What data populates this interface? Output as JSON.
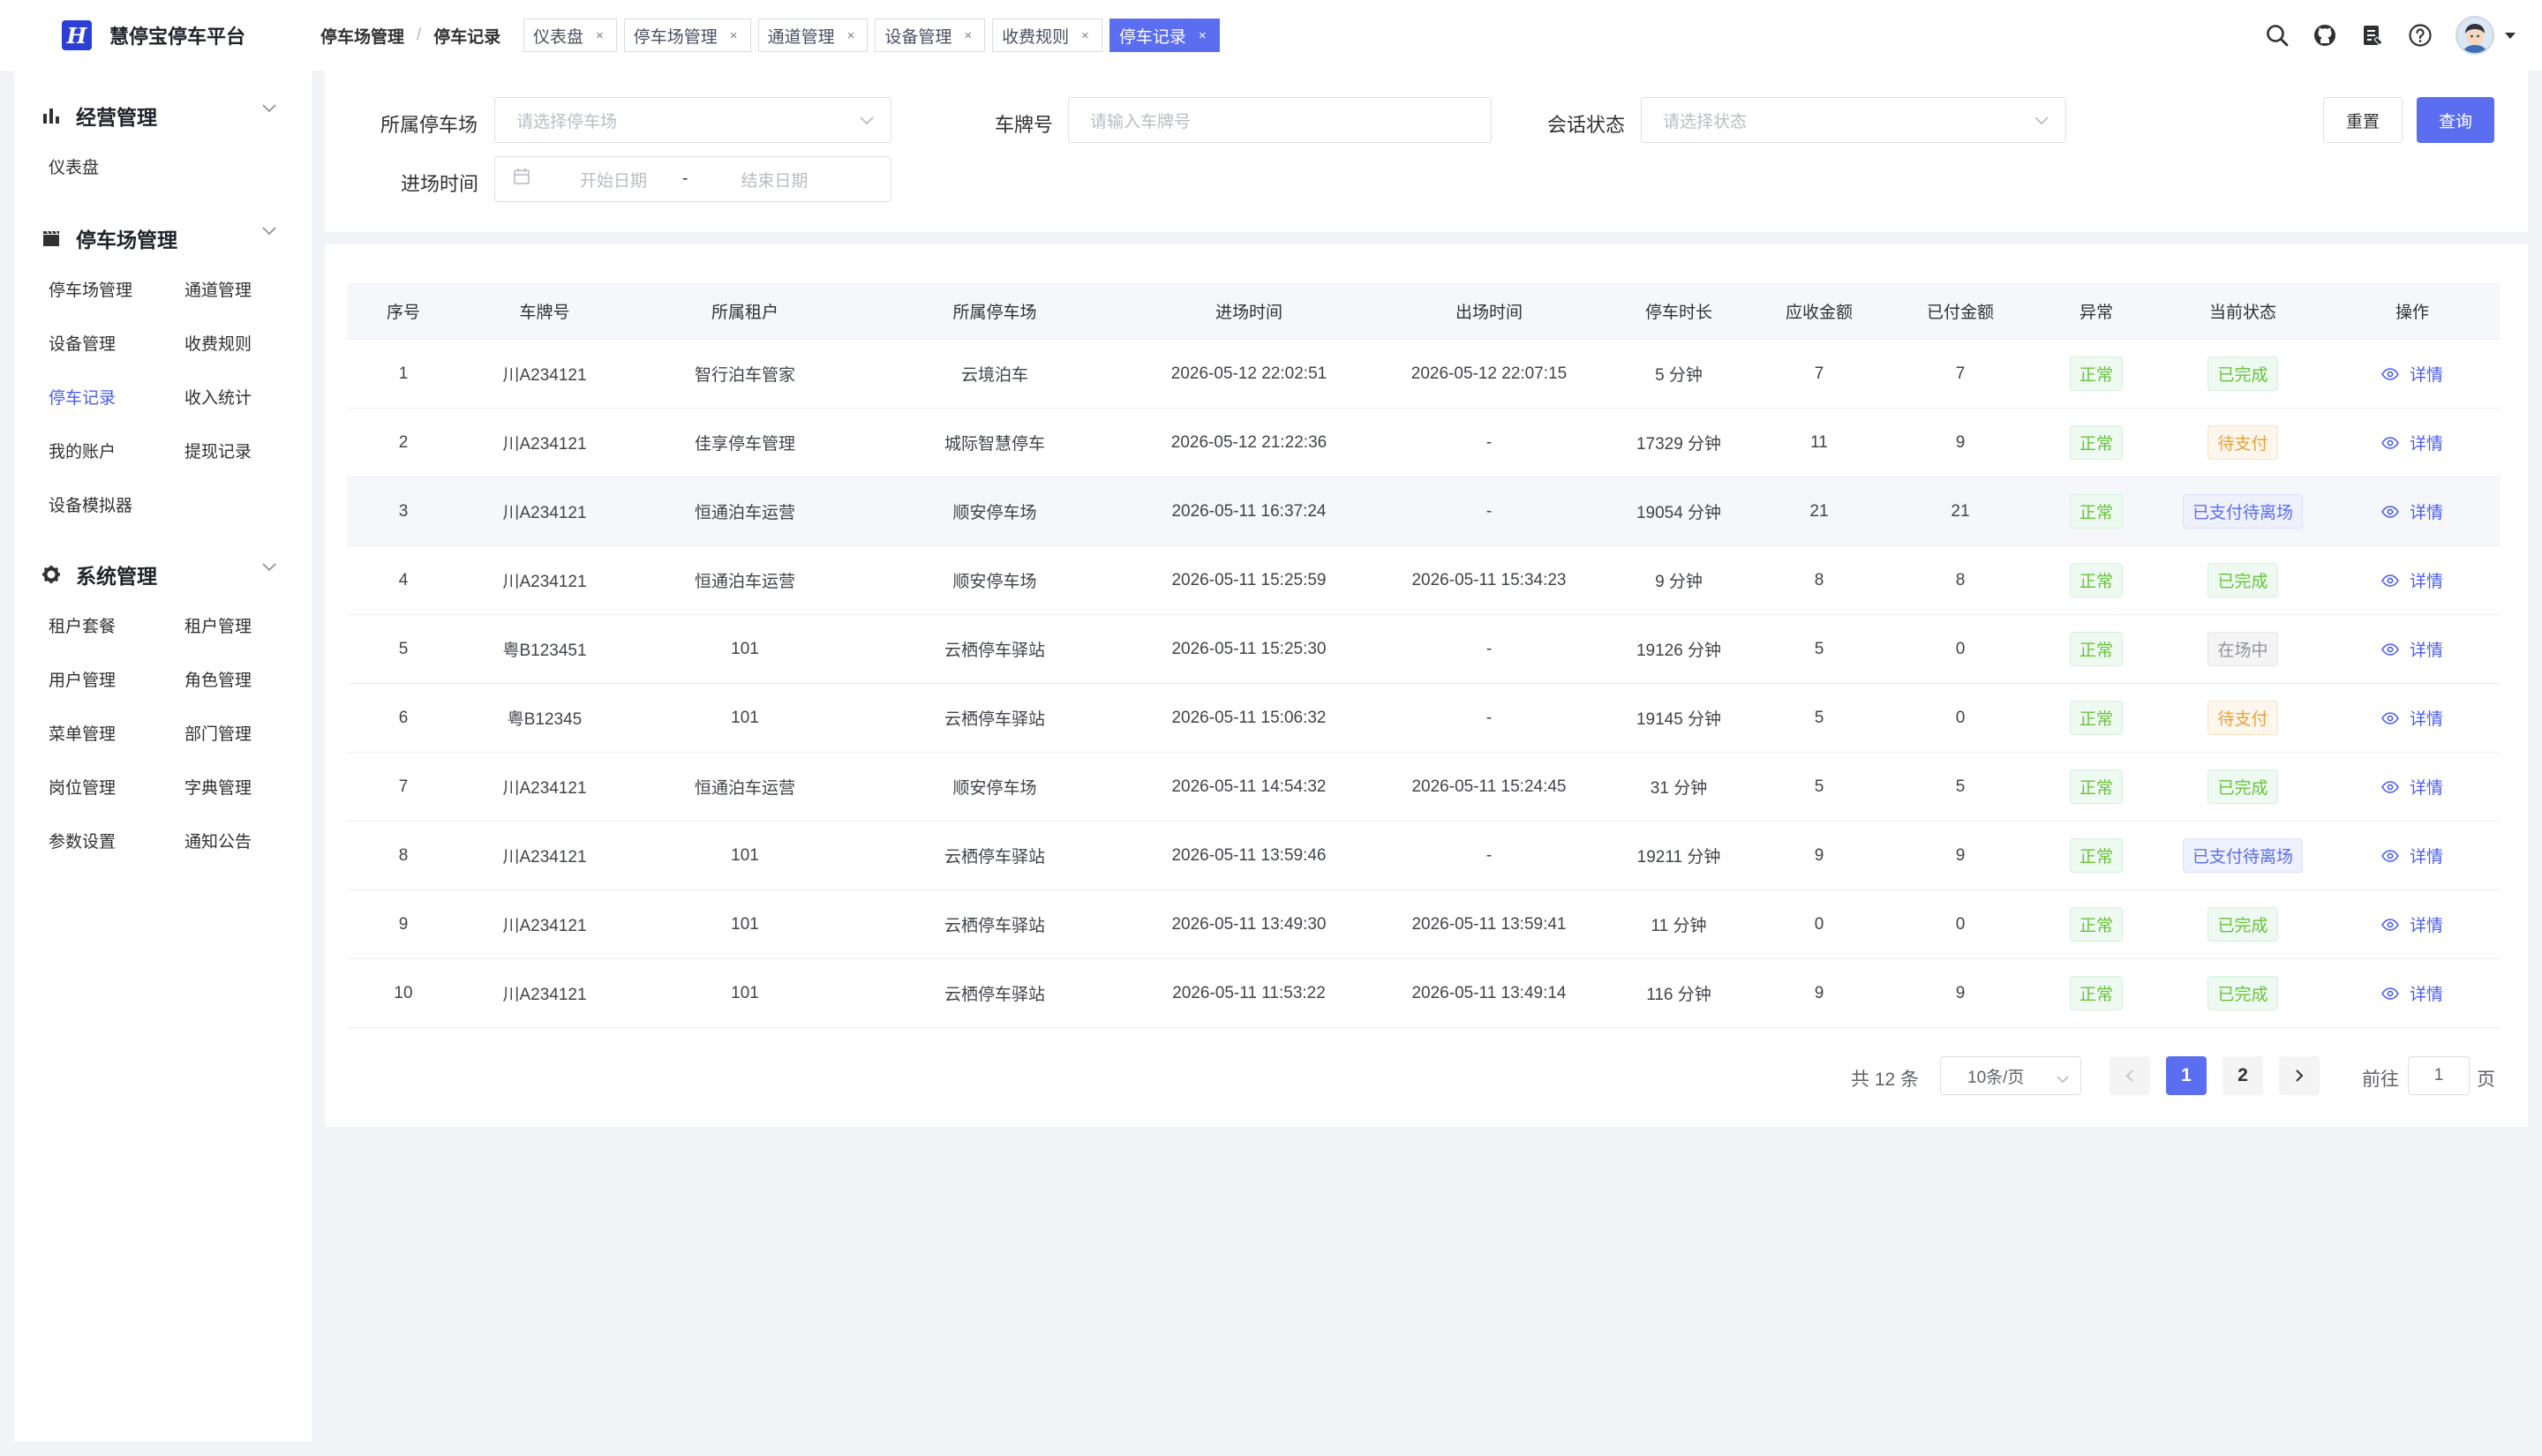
{
  "brand": {
    "name": "慧停宝停车平台",
    "logo_letter": "H"
  },
  "breadcrumb": {
    "parent": "停车场管理",
    "separator": "/",
    "current": "停车记录"
  },
  "tags": [
    {
      "label": "仪表盘",
      "close": "×",
      "active": false
    },
    {
      "label": "停车场管理",
      "close": "×",
      "active": false
    },
    {
      "label": "通道管理",
      "close": "×",
      "active": false
    },
    {
      "label": "设备管理",
      "close": "×",
      "active": false
    },
    {
      "label": "收费规则",
      "close": "×",
      "active": false
    },
    {
      "label": "停车记录",
      "close": "×",
      "active": true
    }
  ],
  "header_icons": [
    "search-icon",
    "github-icon",
    "document-icon",
    "help-icon",
    "avatar"
  ],
  "sidebar": {
    "groups": [
      {
        "title": "经营管理",
        "icon": "bar-chart-icon",
        "items": [
          "仪表盘"
        ]
      },
      {
        "title": "停车场管理",
        "icon": "clapperboard-icon",
        "items": [
          "停车场管理",
          "通道管理",
          "设备管理",
          "收费规则",
          "停车记录",
          "收入统计",
          "我的账户",
          "提现记录",
          "设备模拟器"
        ]
      },
      {
        "title": "系统管理",
        "icon": "gear-icon",
        "items": [
          "租户套餐",
          "租户管理",
          "用户管理",
          "角色管理",
          "菜单管理",
          "部门管理",
          "岗位管理",
          "字典管理",
          "参数设置",
          "通知公告"
        ]
      }
    ],
    "active_item": "停车记录"
  },
  "filters": {
    "lot_label": "所属停车场",
    "lot_placeholder": "请选择停车场",
    "plate_label": "车牌号",
    "plate_placeholder": "请输入车牌号",
    "status_label": "会话状态",
    "status_placeholder": "请选择状态",
    "entry_label": "进场时间",
    "start_placeholder": "开始日期",
    "range_sep": "-",
    "end_placeholder": "结束日期",
    "reset_label": "重置",
    "query_label": "查询"
  },
  "table": {
    "columns": [
      "序号",
      "车牌号",
      "所属租户",
      "所属停车场",
      "进场时间",
      "出场时间",
      "停车时长",
      "应收金额",
      "已付金额",
      "异常",
      "当前状态",
      "操作"
    ],
    "action_label": "详情",
    "rows": [
      {
        "no": "1",
        "plate": "川A234121",
        "tenant": "智行泊车管家",
        "lot": "云境泊车",
        "entry": "2026-05-12 22:02:51",
        "exit": "2026-05-12 22:07:15",
        "duration": "5 分钟",
        "due": "7",
        "paid": "7",
        "abnormal": "正常",
        "status": "已完成",
        "status_type": "done"
      },
      {
        "no": "2",
        "plate": "川A234121",
        "tenant": "佳享停车管理",
        "lot": "城际智慧停车",
        "entry": "2026-05-12 21:22:36",
        "exit": "-",
        "duration": "17329 分钟",
        "due": "11",
        "paid": "9",
        "abnormal": "正常",
        "status": "待支付",
        "status_type": "pending"
      },
      {
        "no": "3",
        "plate": "川A234121",
        "tenant": "恒通泊车运营",
        "lot": "顺安停车场",
        "entry": "2026-05-11 16:37:24",
        "exit": "-",
        "duration": "19054 分钟",
        "due": "21",
        "paid": "21",
        "abnormal": "正常",
        "status": "已支付待离场",
        "status_type": "paid"
      },
      {
        "no": "4",
        "plate": "川A234121",
        "tenant": "恒通泊车运营",
        "lot": "顺安停车场",
        "entry": "2026-05-11 15:25:59",
        "exit": "2026-05-11 15:34:23",
        "duration": "9 分钟",
        "due": "8",
        "paid": "8",
        "abnormal": "正常",
        "status": "已完成",
        "status_type": "done"
      },
      {
        "no": "5",
        "plate": "粤B123451",
        "tenant": "101",
        "lot": "云栖停车驿站",
        "entry": "2026-05-11 15:25:30",
        "exit": "-",
        "duration": "19126 分钟",
        "due": "5",
        "paid": "0",
        "abnormal": "正常",
        "status": "在场中",
        "status_type": "in"
      },
      {
        "no": "6",
        "plate": "粤B12345",
        "tenant": "101",
        "lot": "云栖停车驿站",
        "entry": "2026-05-11 15:06:32",
        "exit": "-",
        "duration": "19145 分钟",
        "due": "5",
        "paid": "0",
        "abnormal": "正常",
        "status": "待支付",
        "status_type": "pending"
      },
      {
        "no": "7",
        "plate": "川A234121",
        "tenant": "恒通泊车运营",
        "lot": "顺安停车场",
        "entry": "2026-05-11 14:54:32",
        "exit": "2026-05-11 15:24:45",
        "duration": "31 分钟",
        "due": "5",
        "paid": "5",
        "abnormal": "正常",
        "status": "已完成",
        "status_type": "done"
      },
      {
        "no": "8",
        "plate": "川A234121",
        "tenant": "101",
        "lot": "云栖停车驿站",
        "entry": "2026-05-11 13:59:46",
        "exit": "-",
        "duration": "19211 分钟",
        "due": "9",
        "paid": "9",
        "abnormal": "正常",
        "status": "已支付待离场",
        "status_type": "paid"
      },
      {
        "no": "9",
        "plate": "川A234121",
        "tenant": "101",
        "lot": "云栖停车驿站",
        "entry": "2026-05-11 13:49:30",
        "exit": "2026-05-11 13:59:41",
        "duration": "11 分钟",
        "due": "0",
        "paid": "0",
        "abnormal": "正常",
        "status": "已完成",
        "status_type": "done"
      },
      {
        "no": "10",
        "plate": "川A234121",
        "tenant": "101",
        "lot": "云栖停车驿站",
        "entry": "2026-05-11 11:53:22",
        "exit": "2026-05-11 13:49:14",
        "duration": "116 分钟",
        "due": "9",
        "paid": "9",
        "abnormal": "正常",
        "status": "已完成",
        "status_type": "done"
      }
    ]
  },
  "pagination": {
    "total_text": "共 12 条",
    "page_size": "10条/页",
    "pages": [
      "1",
      "2"
    ],
    "current_page": "1",
    "goto_label": "前往",
    "goto_value": "1",
    "page_suffix": "页"
  },
  "colors": {
    "primary": "#5b6ef0",
    "success": "#67c23a",
    "warning": "#e6a23c",
    "info": "#909399"
  }
}
